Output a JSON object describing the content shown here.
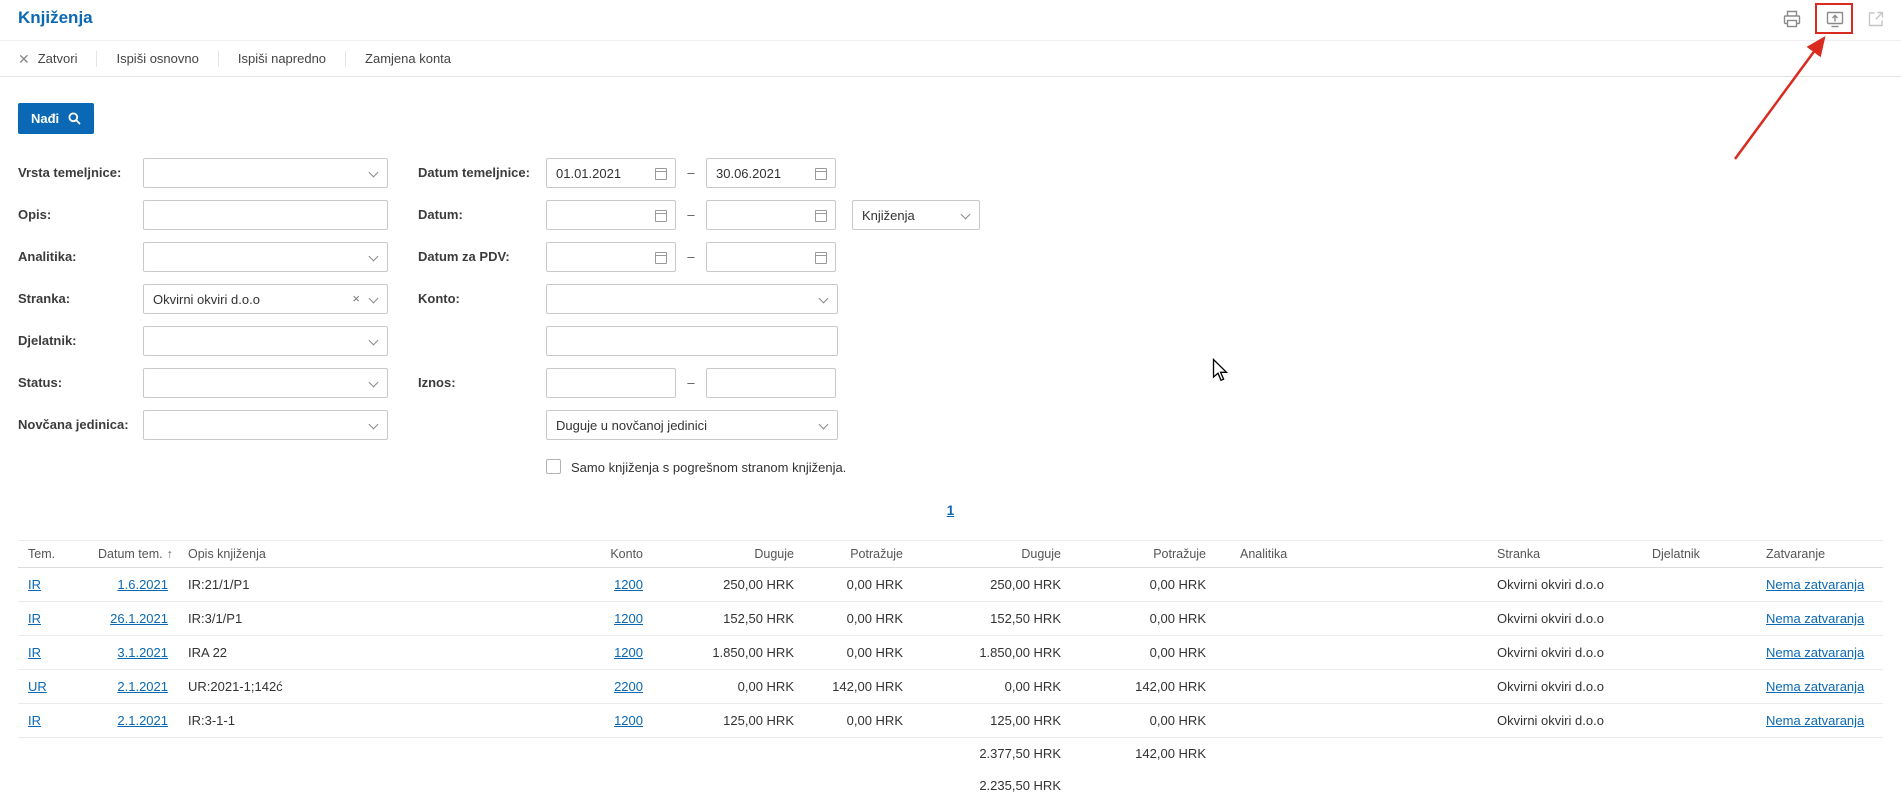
{
  "colors": {
    "accent_blue": "#0a68b4",
    "highlight_red": "#d92b1f"
  },
  "page": {
    "title": "Knjiženja"
  },
  "icons": {
    "close": "✕",
    "clear": "×"
  },
  "toolbar": {
    "close": "Zatvori",
    "print_basic": "Ispiši osnovno",
    "print_advanced": "Ispiši napredno",
    "replace_account": "Zamjena konta"
  },
  "search": {
    "find": "Nađi"
  },
  "filters": {
    "vrsta_label": "Vrsta temeljnice:",
    "opis_label": "Opis:",
    "analitika_label": "Analitika:",
    "stranka_label": "Stranka:",
    "stranka_value": "Okvirni okviri d.o.o",
    "djelatnik_label": "Djelatnik:",
    "status_label": "Status:",
    "novcana_label": "Novčana jedinica:",
    "datum_temeljnice_label": "Datum temeljnice:",
    "datum_temeljnice_from": "01.01.2021",
    "datum_temeljnice_to": "30.06.2021",
    "datum_label": "Datum:",
    "datum_mode_value": "Knjiženja",
    "datum_pdv_label": "Datum za PDV:",
    "konto_label": "Konto:",
    "iznos_label": "Iznos:",
    "iznos_mode_value": "Duguje u novčanoj jedinici",
    "checkbox_label": "Samo knjiženja s pogrešnom stranom knjiženja.",
    "range_dash": "–"
  },
  "pagination": {
    "current_page": "1"
  },
  "table": {
    "headers": {
      "tem": "Tem.",
      "datum": "Datum tem.",
      "sort_arrow": "↑",
      "opis": "Opis knjiženja",
      "konto": "Konto",
      "duguje1": "Duguje",
      "potrazuje1": "Potražuje",
      "duguje2": "Duguje",
      "potrazuje2": "Potražuje",
      "analitika": "Analitika",
      "stranka": "Stranka",
      "djelatnik": "Djelatnik",
      "zatvaranje": "Zatvaranje"
    },
    "rows": [
      {
        "tem": "IR",
        "datum": "1.6.2021",
        "opis": "IR:21/1/P1",
        "konto": "1200",
        "duguje1": "250,00 HRK",
        "potrazuje1": "0,00 HRK",
        "duguje2": "250,00 HRK",
        "potrazuje2": "0,00 HRK",
        "analitika": "",
        "stranka": "Okvirni okviri d.o.o",
        "djelatnik": "",
        "zatvaranje": "Nema zatvaranja"
      },
      {
        "tem": "IR",
        "datum": "26.1.2021",
        "opis": "IR:3/1/P1",
        "konto": "1200",
        "duguje1": "152,50 HRK",
        "potrazuje1": "0,00 HRK",
        "duguje2": "152,50 HRK",
        "potrazuje2": "0,00 HRK",
        "analitika": "",
        "stranka": "Okvirni okviri d.o.o",
        "djelatnik": "",
        "zatvaranje": "Nema zatvaranja"
      },
      {
        "tem": "IR",
        "datum": "3.1.2021",
        "opis": "IRA 22",
        "konto": "1200",
        "duguje1": "1.850,00 HRK",
        "potrazuje1": "0,00 HRK",
        "duguje2": "1.850,00 HRK",
        "potrazuje2": "0,00 HRK",
        "analitika": "",
        "stranka": "Okvirni okviri d.o.o",
        "djelatnik": "",
        "zatvaranje": "Nema zatvaranja"
      },
      {
        "tem": "UR",
        "datum": "2.1.2021",
        "opis": "UR:2021-1;142ć",
        "konto": "2200",
        "duguje1": "0,00 HRK",
        "potrazuje1": "142,00 HRK",
        "duguje2": "0,00 HRK",
        "potrazuje2": "142,00 HRK",
        "analitika": "",
        "stranka": "Okvirni okviri d.o.o",
        "djelatnik": "",
        "zatvaranje": "Nema zatvaranja"
      },
      {
        "tem": "IR",
        "datum": "2.1.2021",
        "opis": "IR:3-1-1",
        "konto": "1200",
        "duguje1": "125,00 HRK",
        "potrazuje1": "0,00 HRK",
        "duguje2": "125,00 HRK",
        "potrazuje2": "0,00 HRK",
        "analitika": "",
        "stranka": "Okvirni okviri d.o.o",
        "djelatnik": "",
        "zatvaranje": "Nema zatvaranja"
      }
    ],
    "totals": {
      "duguje_sum": "2.377,50 HRK",
      "potrazuje_sum": "142,00 HRK",
      "saldo": "2.235,50 HRK"
    }
  }
}
